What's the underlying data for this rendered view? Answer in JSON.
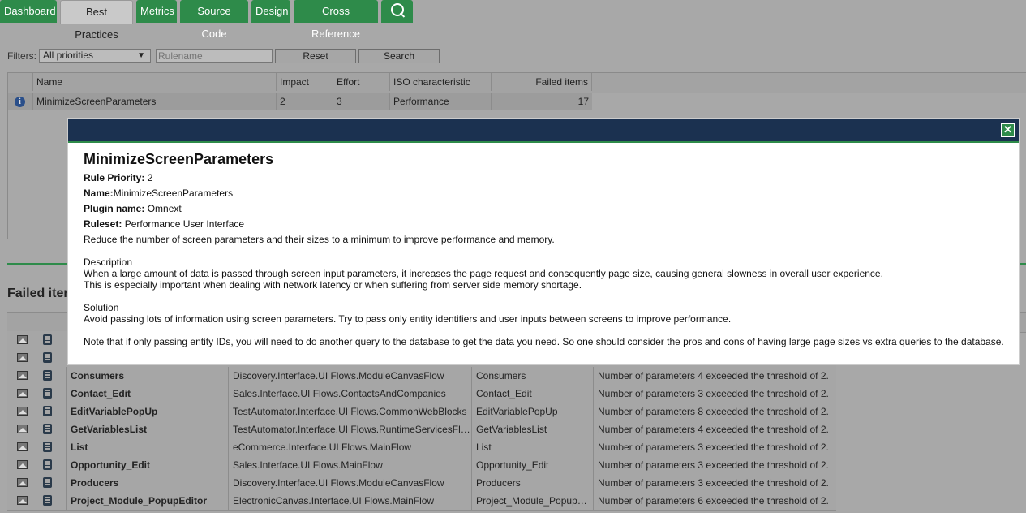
{
  "tabs": [
    {
      "label": "Dashboard"
    },
    {
      "label": "Best Practices"
    },
    {
      "label": "Metrics"
    },
    {
      "label": "Source Code"
    },
    {
      "label": "Design"
    },
    {
      "label": "Cross Reference"
    }
  ],
  "filters": {
    "label": "Filters:",
    "priority_value": "All priorities",
    "rulename_placeholder": "Rulename",
    "reset_label": "Reset",
    "search_label": "Search"
  },
  "rules_table": {
    "headers": {
      "name": "Name",
      "impact": "Impact",
      "effort": "Effort",
      "iso": "ISO characteristic",
      "failed": "Failed items"
    },
    "row": {
      "name": "MinimizeScreenParameters",
      "impact": "2",
      "effort": "3",
      "iso": "Performance",
      "failed": "17"
    }
  },
  "failed_section": {
    "title": "Failed iter"
  },
  "failed_items": [
    {
      "name": "Consumers",
      "module": "Discovery.Interface.UI Flows.ModuleCanvasFlow",
      "screen": "Consumers",
      "message": "Number of parameters 4 exceeded the threshold of 2."
    },
    {
      "name": "Contact_Edit",
      "module": "Sales.Interface.UI Flows.ContactsAndCompanies",
      "screen": "Contact_Edit",
      "message": "Number of parameters 3 exceeded the threshold of 2."
    },
    {
      "name": "EditVariablePopUp",
      "module": "TestAutomator.Interface.UI Flows.CommonWebBlocks",
      "screen": "EditVariablePopUp",
      "message": "Number of parameters 8 exceeded the threshold of 2."
    },
    {
      "name": "GetVariablesList",
      "module": "TestAutomator.Interface.UI Flows.RuntimeServicesFlow",
      "screen": "GetVariablesList",
      "message": "Number of parameters 4 exceeded the threshold of 2."
    },
    {
      "name": "List",
      "module": "eCommerce.Interface.UI Flows.MainFlow",
      "screen": "List",
      "message": "Number of parameters 3 exceeded the threshold of 2."
    },
    {
      "name": "Opportunity_Edit",
      "module": "Sales.Interface.UI Flows.MainFlow",
      "screen": "Opportunity_Edit",
      "message": "Number of parameters 3 exceeded the threshold of 2."
    },
    {
      "name": "Producers",
      "module": "Discovery.Interface.UI Flows.ModuleCanvasFlow",
      "screen": "Producers",
      "message": "Number of parameters 3 exceeded the threshold of 2."
    },
    {
      "name": "Project_Module_PopupEditor",
      "module": "ElectronicCanvas.Interface.UI Flows.MainFlow",
      "screen": "Project_Module_PopupEditor",
      "message": "Number of parameters 6 exceeded the threshold of 2."
    }
  ],
  "modal": {
    "title": "MinimizeScreenParameters",
    "priority_label": "Rule Priority:",
    "priority_value": "2",
    "name_label": "Name:",
    "name_value": "MinimizeScreenParameters",
    "plugin_label": "Plugin name:",
    "plugin_value": "Omnext",
    "ruleset_label": "Ruleset:",
    "ruleset_value": "Performance User Interface",
    "summary": "Reduce the number of screen parameters and their sizes to a minimum to improve performance and memory.",
    "description_heading": "Description",
    "description_line1": "When a large amount of data is passed through screen input parameters, it increases the page request and consequently page size, causing general slowness in overall user experience.",
    "description_line2": "This is especially important when dealing with network latency or when suffering from server side memory shortage.",
    "solution_heading": "Solution",
    "solution_text": "Avoid passing lots of information using screen parameters. Try to pass only entity identifiers and user inputs between screens to improve performance.",
    "note": "Note that if only passing entity IDs, you will need to do another query to the database to get the data you need. So one should consider the pros and cons of having large page sizes vs extra queries to the database."
  },
  "colors": {
    "accent_green": "#2e8b4a",
    "modal_header": "#1b3150"
  }
}
